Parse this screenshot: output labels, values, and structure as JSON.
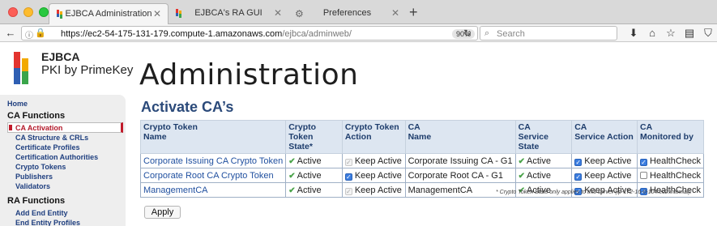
{
  "browser": {
    "tabs": [
      {
        "label": "EJBCA Administration",
        "active": true
      },
      {
        "label": "EJBCA's RA GUI",
        "active": false
      },
      {
        "label": "Preferences",
        "active": false
      }
    ],
    "url_host": "https://ec2-54-175-131-179.compute-1.amazonaws.com",
    "url_path": "/ejbca/adminweb/",
    "zoom": "90%",
    "search_placeholder": "Search"
  },
  "logo": {
    "title": "EJBCA",
    "subtitle": "PKI by PrimeKey",
    "colors": [
      "#e3342f",
      "#2f5fb3",
      "#f2a900",
      "#3aa54a"
    ]
  },
  "page": {
    "title": "Administration",
    "section": "Activate CA’s"
  },
  "sidebar": {
    "home": "Home",
    "ca_functions": "CA Functions",
    "ca_items": [
      "CA Activation",
      "CA Structure & CRLs",
      "Certificate Profiles",
      "Certification Authorities",
      "Crypto Tokens",
      "Publishers",
      "Validators"
    ],
    "ra_functions": "RA Functions",
    "ra_items": [
      "Add End Entity",
      "End Entity Profiles"
    ]
  },
  "table": {
    "headers": [
      [
        "Crypto Token",
        "Name"
      ],
      [
        "Crypto Token",
        "State*"
      ],
      [
        "Crypto Token",
        "Action"
      ],
      [
        "CA",
        "Name"
      ],
      [
        "CA",
        "Service State"
      ],
      [
        "CA",
        "Service Action"
      ],
      [
        "CA",
        "Monitored by"
      ]
    ],
    "rows": [
      {
        "token": "Corporate Issuing CA Crypto Token",
        "state": "Active",
        "action": "Keep Active",
        "action_checked": true,
        "action_disabled": true,
        "ca": "Corporate Issuing CA - G1",
        "service_state": "Active",
        "service_action": "Keep Active",
        "service_checked": true,
        "monitor": "HealthCheck",
        "monitor_checked": true
      },
      {
        "token": "Corporate Root CA Crypto Token",
        "state": "Active",
        "action": "Keep Active",
        "action_checked": true,
        "action_disabled": false,
        "ca": "Corporate Root CA - G1",
        "service_state": "Active",
        "service_action": "Keep Active",
        "service_checked": true,
        "monitor": "HealthCheck",
        "monitor_checked": false
      },
      {
        "token": "ManagementCA",
        "state": "Active",
        "action": "Keep Active",
        "action_checked": true,
        "action_disabled": true,
        "ca": "ManagementCA",
        "service_state": "Active",
        "service_action": "Keep Active",
        "service_checked": true,
        "monitor": "HealthCheck",
        "monitor_checked": true
      }
    ],
    "footnote": "* Crypto Token State only applies to this server (ip-172-16-0-104.ec2.internal)."
  },
  "apply_label": "Apply",
  "colors": {
    "link": "#1f4f9f",
    "header_bg": "#dde6f1",
    "active_red": "#c11a2a",
    "title_blue": "#2b4a7a",
    "ok_green": "#4aa34a"
  }
}
